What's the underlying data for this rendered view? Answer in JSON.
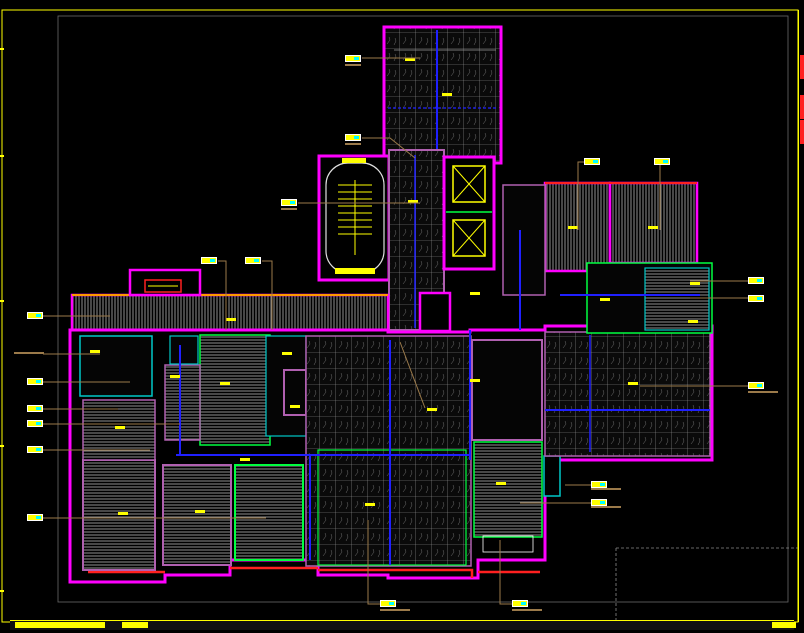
{
  "drawing": {
    "type": "floor plan",
    "colors": {
      "background": "#000000",
      "frame": "#ffff00",
      "wall_outer": "#ff00ff",
      "wall_inner": "#b060b0",
      "partition_green": "#00ff40",
      "partition_cyan": "#00c8c8",
      "red_edge": "#ff2020",
      "orange_edge": "#ff9900",
      "blue_pipe": "#2020ff",
      "hatch_white": "#d8d8d8",
      "label_yellow": "#ffff00",
      "leader": "#b09060"
    },
    "icons": [
      "elevator-icon",
      "stair-icon",
      "hatch-pattern-icon"
    ]
  }
}
